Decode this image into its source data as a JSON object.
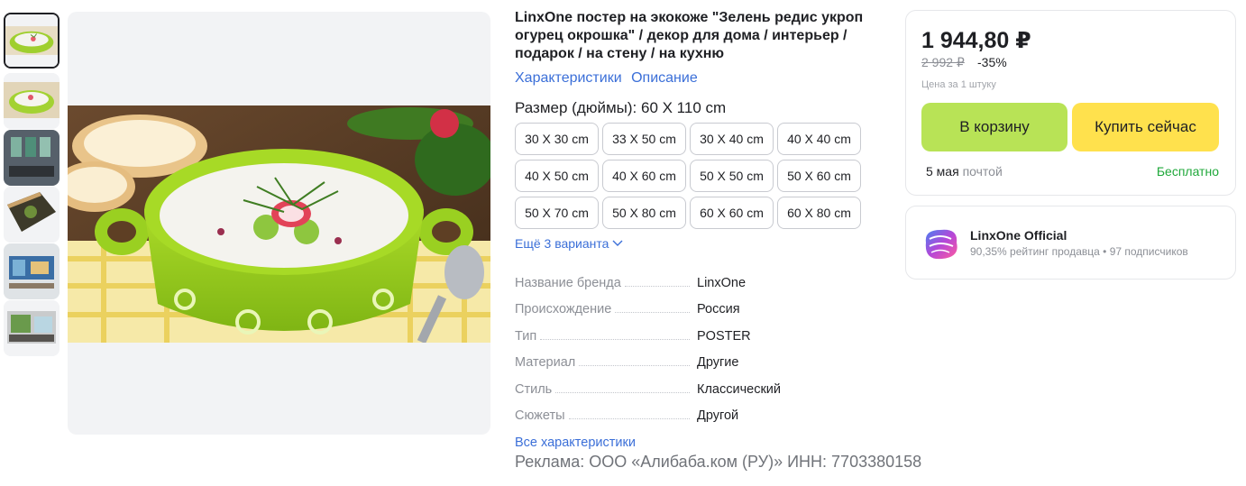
{
  "product": {
    "title": "LinxOne постер на экокоже \"Зелень редис укроп огурец окрошка\" / декор для дома / интерьер / подарок / на стену / на кухню",
    "links": [
      "Характеристики",
      "Описание"
    ],
    "size_label": "Размер (дюймы): 60 X 110 cm",
    "sizes": [
      "30 X 30 cm",
      "33 X 50 cm",
      "30 X 40 cm",
      "40 X 40 cm",
      "40 X 50 cm",
      "40 X 60 cm",
      "50 X 50 cm",
      "50 X 60 cm",
      "50 X 70 cm",
      "50 X 80 cm",
      "60 X 60 cm",
      "60 X 80 cm"
    ],
    "more_variants": "Ещё 3 варианта",
    "specs": [
      {
        "key": "Название бренда",
        "value": "LinxOne"
      },
      {
        "key": "Происхождение",
        "value": "Россия"
      },
      {
        "key": "Тип",
        "value": "POSTER"
      },
      {
        "key": "Материал",
        "value": "Другие"
      },
      {
        "key": "Стиль",
        "value": "Классический"
      },
      {
        "key": "Сюжеты",
        "value": "Другой"
      }
    ],
    "all_specs": "Все характеристики",
    "ad_note": "Реклама: ООО «Алибаба.ком (РУ)» ИНН: 7703380158"
  },
  "gallery": {
    "thumbnails": [
      "soup-bowl",
      "soup-bowl-alt",
      "room-interior",
      "poster-angle",
      "room-wall",
      "living-room"
    ]
  },
  "pricing": {
    "price": "1 944,80 ₽",
    "old_price": "2 992 ₽",
    "discount": "-35%",
    "unit_note": "Цена за 1 штуку",
    "cart_button": "В корзину",
    "buy_button": "Купить сейчас",
    "delivery_date": "5 мая",
    "delivery_method": "почтой",
    "delivery_cost": "Бесплатно",
    "accent_cart": "#b8e356",
    "accent_buy": "#ffe14d",
    "accent_free": "#1fa83a"
  },
  "seller": {
    "name": "LinxOne Official",
    "rating": "90,35% рейтинг продавца",
    "separator": "•",
    "subscribers": "97 подписчиков"
  },
  "colors": {
    "link": "#3b6fd8"
  }
}
